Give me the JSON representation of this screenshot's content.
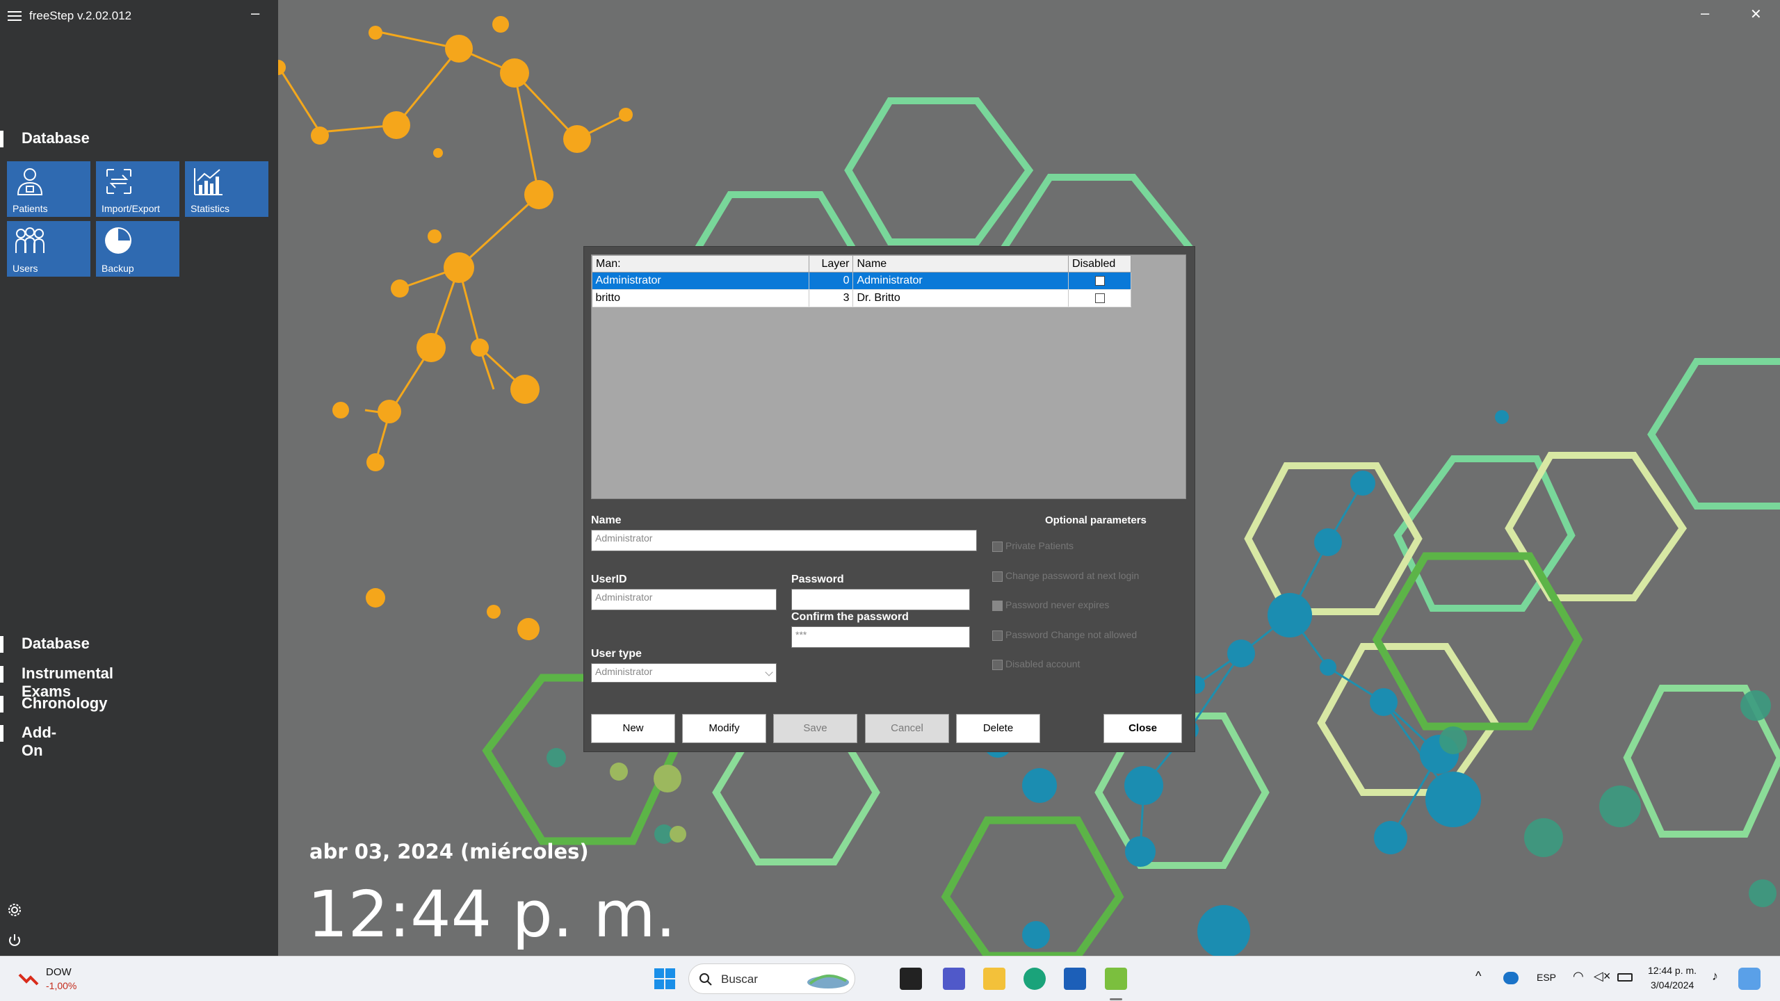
{
  "window": {
    "title": "freeStep v.2.02.012",
    "minimize": "–",
    "close": "✕"
  },
  "sidebar": {
    "section_top": "Database",
    "tiles": [
      {
        "label": "Patients",
        "icon": "patients-icon"
      },
      {
        "label": "Import/Export",
        "icon": "import-export-icon"
      },
      {
        "label": "Statistics",
        "icon": "statistics-icon"
      },
      {
        "label": "Users",
        "icon": "users-icon"
      },
      {
        "label": "Backup",
        "icon": "backup-icon"
      }
    ],
    "menu": [
      "Database",
      "Instrumental Exams",
      "Chronology",
      "Add-On"
    ],
    "settings_icon": "gear-icon",
    "power_icon": "power-icon"
  },
  "clock": {
    "date": "abr 03, 2024 (miércoles)",
    "time": "12:44 p. m."
  },
  "dialog": {
    "columns": [
      "Man:",
      "Layer",
      "Name",
      "Disabled"
    ],
    "rows": [
      {
        "man": "Administrator",
        "layer": "0",
        "name": "Administrator",
        "disabled": false,
        "selected": true
      },
      {
        "man": "britto",
        "layer": "3",
        "name": "Dr. Britto",
        "disabled": false,
        "selected": false
      }
    ],
    "name_label": "Name",
    "name_value": "Administrator",
    "userid_label": "UserID",
    "userid_value": "Administrator",
    "password_label": "Password",
    "password_value": "",
    "confirm_label": "Confirm the password",
    "confirm_value": "***",
    "usertype_label": "User type",
    "usertype_value": "Administrator",
    "optional_title": "Optional parameters",
    "options": [
      {
        "label": "Private Patients",
        "checked": false
      },
      {
        "label": "Change password at next login",
        "checked": false
      },
      {
        "label": "Password never expires",
        "checked": true
      },
      {
        "label": "Password Change not allowed",
        "checked": false
      },
      {
        "label": "Disabled account",
        "checked": false
      }
    ],
    "buttons": {
      "new": "New",
      "modify": "Modify",
      "save": "Save",
      "cancel": "Cancel",
      "delete": "Delete",
      "close": "Close"
    }
  },
  "taskbar": {
    "widget_name": "DOW",
    "widget_value": "-1,00%",
    "search_placeholder": "Buscar",
    "lang": "ESP",
    "time": "12:44 p. m.",
    "date": "3/04/2024",
    "colors": {
      "accent": "#0a79d8",
      "tile": "#2f6ab1"
    }
  }
}
